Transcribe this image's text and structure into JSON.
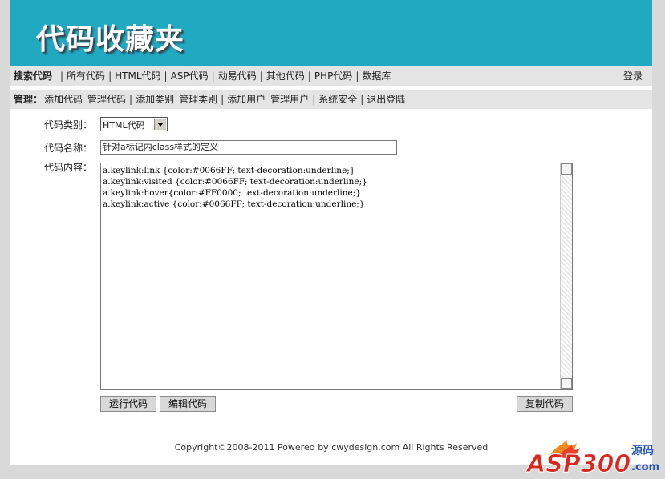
{
  "header": {
    "title": "代码收藏夹"
  },
  "nav": {
    "lead": "搜索代码",
    "items": [
      "所有代码",
      "HTML代码",
      "ASP代码",
      "动易代码",
      "其他代码",
      "PHP代码",
      "数据库"
    ],
    "login": "登录"
  },
  "admin": {
    "lead": "管理：",
    "groups": [
      [
        "添加代码",
        "管理代码"
      ],
      [
        "添加类别",
        "管理类别"
      ],
      [
        "添加用户",
        "管理用户"
      ],
      [
        "系统安全"
      ],
      [
        "退出登陆"
      ]
    ]
  },
  "form": {
    "category_label": "代码类别：",
    "category_value": "HTML代码",
    "name_label": "代码名称：",
    "name_value": "针对a标记内class样式的定义",
    "content_label": "代码内容：",
    "content_lines": [
      "a.keylink:link {color:#0066FF; text-decoration:underline;}",
      "a.keylink:visited {color:#0066FF; text-decoration:underline;}",
      "a.keylink:hover{color:#FF0000; text-decoration:underline;}",
      "a.keylink:active {color:#0066FF; text-decoration:underline;}"
    ]
  },
  "buttons": {
    "run": "运行代码",
    "edit": "编辑代码",
    "copy": "复制代码"
  },
  "footer": {
    "text": "Copyright©2008-2011 Powered by cwydesign.com All Rights Reserved"
  },
  "watermark": {
    "brand": "ASP300",
    "sub": "源码",
    "domain": ".com"
  },
  "colors": {
    "header_bg": "#21a9c2",
    "bar_bg": "#e4e4e4",
    "page_bg": "#d9d9d9"
  }
}
